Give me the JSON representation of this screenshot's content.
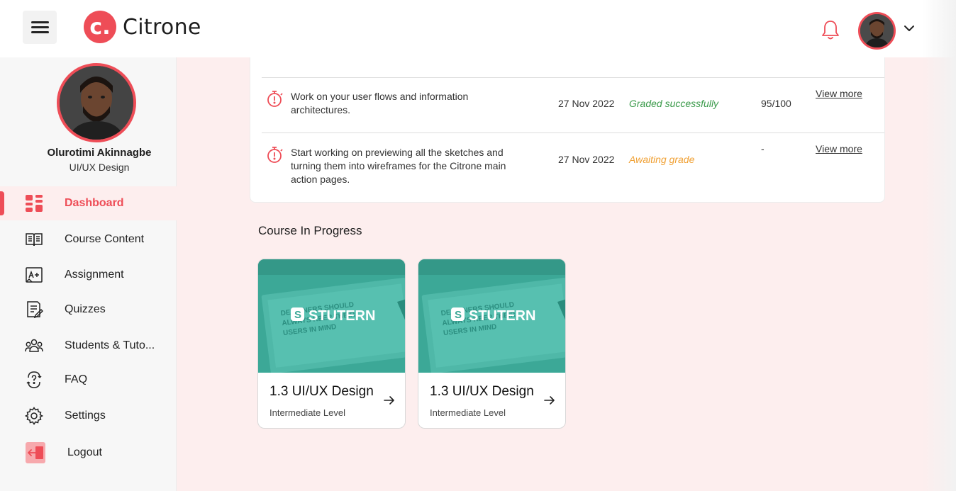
{
  "app": {
    "name": "Citrone",
    "logo_letter": "c."
  },
  "user": {
    "name": "Olurotimi Akinnagbe",
    "role": "UI/UX Design"
  },
  "sidebar": {
    "items": [
      {
        "label": "Dashboard",
        "icon": "dashboard-icon",
        "active": true
      },
      {
        "label": "Course Content",
        "icon": "book-icon",
        "active": false
      },
      {
        "label": "Assignment",
        "icon": "assignment-icon",
        "active": false
      },
      {
        "label": "Quizzes",
        "icon": "quiz-icon",
        "active": false
      },
      {
        "label": "Students & Tuto...",
        "icon": "students-icon",
        "active": false
      },
      {
        "label": "FAQ",
        "icon": "faq-icon",
        "active": false
      },
      {
        "label": "Settings",
        "icon": "gear-icon",
        "active": false
      },
      {
        "label": "Logout",
        "icon": "logout-icon",
        "active": false
      }
    ]
  },
  "assignments": {
    "rows": [
      {
        "title": "Work on your user flows and information architectures.",
        "date": "27 Nov 2022",
        "status": "Graded successfully",
        "score": "95/100",
        "link": "View more"
      },
      {
        "title": "Start working on previewing all the sketches and turning them into wireframes for the Citrone main action pages.",
        "date": "27 Nov 2022",
        "status": "Awaiting grade",
        "score": "-",
        "link": "View more"
      }
    ]
  },
  "courses": {
    "title": "Course In Progress",
    "items": [
      {
        "title": "1.3 UI/UX Design",
        "level": "Intermediate Level",
        "brand": "STUTERN",
        "brand_letter": "S",
        "thumb_text": "DESIGNERS SHOULD ALWAYS KEEP THEIR USERS IN MIND"
      },
      {
        "title": "1.3 UI/UX Design",
        "level": "Intermediate Level",
        "brand": "STUTERN",
        "brand_letter": "S",
        "thumb_text": "DESIGNERS SHOULD ALWAYS KEEP THEIR USERS IN MIND"
      }
    ]
  },
  "colors": {
    "accent": "#ee4d57",
    "graded": "#3a9a4a",
    "awaiting": "#f0a033",
    "page_bg": "#fdeeee",
    "thumb": "#3ca897"
  }
}
